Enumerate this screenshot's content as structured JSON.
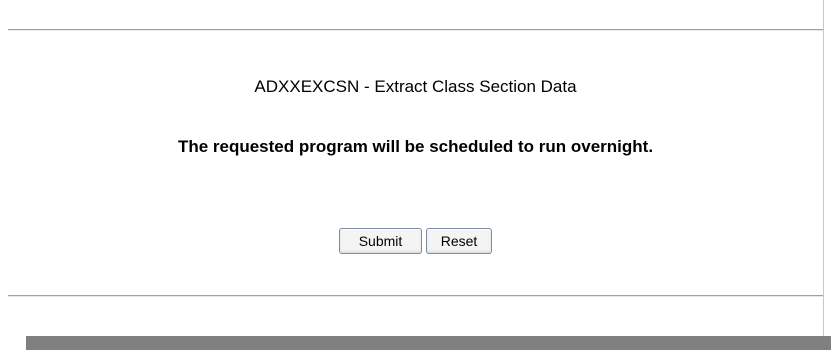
{
  "form": {
    "title": "ADXXEXCSN - Extract Class Section Data",
    "message": "The requested program will be scheduled to run overnight.",
    "submit_label": "Submit",
    "reset_label": "Reset"
  },
  "colors": {
    "background": "#ffffff",
    "rule": "#a0a0a0",
    "shadow_bar": "#808080",
    "button_border": "#7a8ba6"
  }
}
